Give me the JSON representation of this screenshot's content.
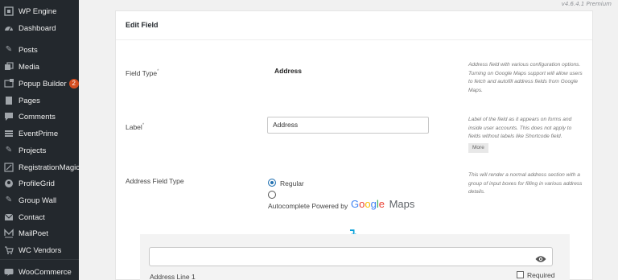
{
  "sidebar": {
    "items": [
      {
        "label": "WP Engine",
        "icon": "wpengine-icon"
      },
      {
        "label": "Dashboard",
        "icon": "dashboard-icon"
      },
      {
        "label": "Posts",
        "icon": "pin-icon"
      },
      {
        "label": "Media",
        "icon": "media-icon"
      },
      {
        "label": "Popup Builder",
        "icon": "popup-icon",
        "badge": "2"
      },
      {
        "label": "Pages",
        "icon": "pages-icon"
      },
      {
        "label": "Comments",
        "icon": "comments-icon"
      },
      {
        "label": "EventPrime",
        "icon": "eventprime-icon"
      },
      {
        "label": "Projects",
        "icon": "pin-icon"
      },
      {
        "label": "RegistrationMagic",
        "icon": "registrationmagic-icon"
      },
      {
        "label": "ProfileGrid",
        "icon": "profilegrid-icon"
      },
      {
        "label": "Group Wall",
        "icon": "pin-icon"
      },
      {
        "label": "Contact",
        "icon": "mail-icon"
      },
      {
        "label": "MailPoet",
        "icon": "mailpoet-icon"
      },
      {
        "label": "WC Vendors",
        "icon": "cart-icon"
      },
      {
        "label": "WooCommerce",
        "icon": "woocommerce-icon"
      }
    ]
  },
  "version": "v4.6.4.1 Premium",
  "card": {
    "title": "Edit Field",
    "field_type": {
      "label": "Field Type",
      "required_mark": "*",
      "value": "Address",
      "help": "Address field with various configuration options. Turning on Google Maps support will allow users to fetch and autofill address fields from Google Maps."
    },
    "label_row": {
      "label": "Label",
      "required_mark": "*",
      "value": "Address",
      "help": "Label of the field as it appears on forms and inside user accounts. This does not apply to fields without labels like Shortcode field.",
      "more": "More"
    },
    "address_type": {
      "label": "Address Field Type",
      "option_regular": "Regular",
      "option_autocomplete": "Autocomplete Powered by",
      "selected": "Regular",
      "help": "This will render a normal address section with a group of input boxes for filling in various address details."
    },
    "preview": {
      "arrow": "↴",
      "line_label": "Address Line 1",
      "required_label": "Required"
    }
  },
  "brand": {
    "google_letters": [
      "G",
      "o",
      "o",
      "g",
      "l",
      "e"
    ],
    "google_colors": [
      "#4285F4",
      "#EA4335",
      "#FBBC05",
      "#4285F4",
      "#34A853",
      "#EA4335"
    ],
    "maps_word": "Maps",
    "maps_color": "#5f6368"
  },
  "colors": {
    "sidebar_bg": "#23282d",
    "accent": "#2271b1",
    "arrow": "#0aa1d9",
    "badge": "#d54e21"
  }
}
